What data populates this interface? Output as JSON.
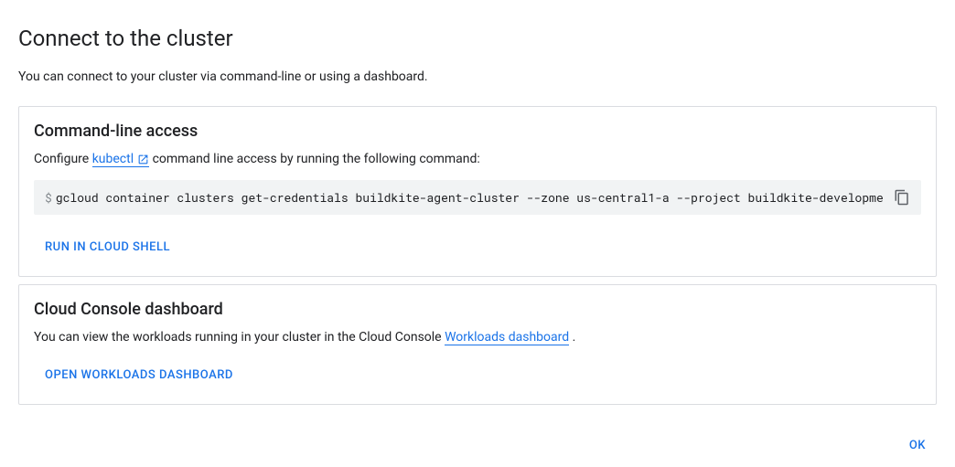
{
  "page_title": "Connect to the cluster",
  "intro_text": "You can connect to your cluster via command-line or using a dashboard.",
  "cli_section": {
    "title": "Command-line access",
    "desc_pre": "Configure ",
    "kubectl_link": "kubectl",
    "desc_post": " command line access by running the following command:",
    "code_prompt": "$",
    "code": "gcloud container clusters get-credentials buildkite-agent-cluster --zone us-central1-a --project buildkite-development",
    "run_button": "Run in Cloud Shell"
  },
  "dashboard_section": {
    "title": "Cloud Console dashboard",
    "desc_pre": "You can view the workloads running in your cluster in the Cloud Console ",
    "workloads_link": "Workloads dashboard",
    "desc_post": " .",
    "open_button": "Open Workloads Dashboard"
  },
  "footer": {
    "ok": "OK"
  }
}
